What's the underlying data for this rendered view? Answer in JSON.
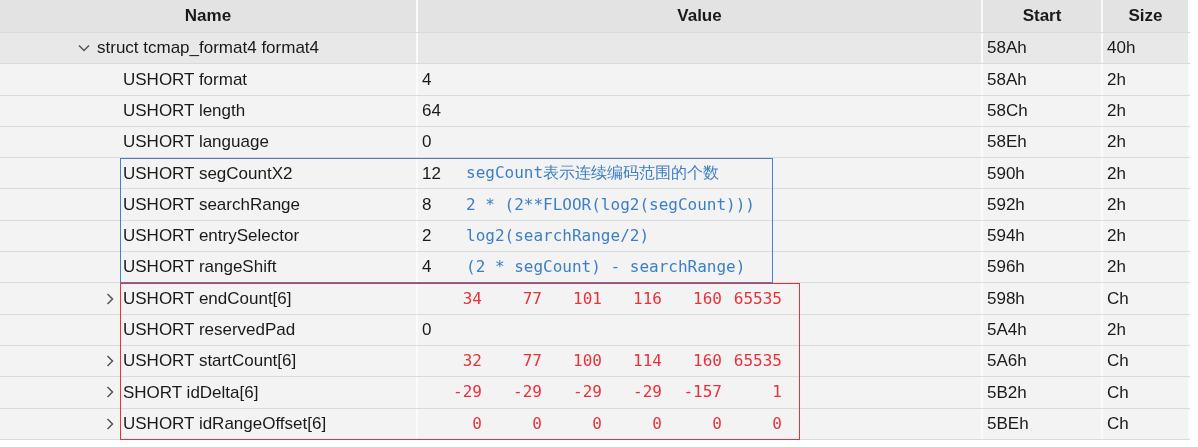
{
  "table": {
    "columns": [
      "Name",
      "Value",
      "Start",
      "Size"
    ],
    "rows": [
      {
        "name": "struct tcmap_format4 format4",
        "value": "",
        "start": "58Ah",
        "size": "40h",
        "expanded": true,
        "children": [
          {
            "name": "USHORT format",
            "value": "4",
            "start": "58Ah",
            "size": "2h"
          },
          {
            "name": "USHORT length",
            "value": "64",
            "start": "58Ch",
            "size": "2h"
          },
          {
            "name": "USHORT language",
            "value": "0",
            "start": "58Eh",
            "size": "2h"
          },
          {
            "name": "USHORT segCountX2",
            "value": "12",
            "note": "segCount表示连续编码范围的个数",
            "color": "#4a7fc1",
            "start": "590h",
            "size": "2h"
          },
          {
            "name": "USHORT searchRange",
            "value": "8",
            "note": "2 * (2**FLOOR(log2(segCount)))",
            "color": "#4a7fc1",
            "start": "592h",
            "size": "2h"
          },
          {
            "name": "USHORT entrySelector",
            "value": "2",
            "note": "log2(searchRange/2)",
            "color": "#4a7fc1",
            "start": "594h",
            "size": "2h"
          },
          {
            "name": "USHORT rangeShift",
            "value": "4",
            "note": "(2 * segCount) - searchRange)",
            "color": "#4a7fc1",
            "start": "596h",
            "size": "2h"
          },
          {
            "name": "USHORT endCount[6]",
            "expanded": false,
            "items": [
              "34",
              "77",
              "101",
              "116",
              "160",
              "65535"
            ],
            "color": "#e8323a",
            "start": "598h",
            "size": "Ch"
          },
          {
            "name": "USHORT reservedPad",
            "value": "0",
            "color": "#e8323a",
            "start": "5A4h",
            "size": "2h"
          },
          {
            "name": "USHORT startCount[6]",
            "expanded": false,
            "items": [
              "32",
              "77",
              "100",
              "114",
              "160",
              "65535"
            ],
            "color": "#e8323a",
            "start": "5A6h",
            "size": "Ch"
          },
          {
            "name": "SHORT idDelta[6]",
            "expanded": false,
            "items": [
              "-29",
              "-29",
              "-29",
              "-29",
              "-157",
              "1"
            ],
            "color": "#e8323a",
            "start": "5B2h",
            "size": "Ch"
          },
          {
            "name": "USHORT idRangeOffset[6]",
            "expanded": false,
            "items": [
              "0",
              "0",
              "0",
              "0",
              "0",
              "0"
            ],
            "color": "#e8323a",
            "start": "5BEh",
            "size": "Ch"
          }
        ]
      }
    ]
  }
}
